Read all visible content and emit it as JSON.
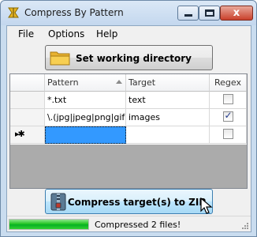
{
  "window": {
    "title": "Compress By Pattern",
    "icon": "compress-app-icon",
    "controls": {
      "minimize": "minimize-icon",
      "maximize": "maximize-icon",
      "close_label": "x"
    }
  },
  "menu": [
    {
      "label": "File"
    },
    {
      "label": "Options"
    },
    {
      "label": "Help"
    }
  ],
  "buttons": {
    "set_working_directory": "Set working directory",
    "compress_zip": "Compress target(s) to ZIP"
  },
  "grid": {
    "columns": {
      "pattern": "Pattern",
      "target": "Target",
      "regex": "Regex"
    },
    "sort_column": "Pattern",
    "rows": [
      {
        "pattern": "*.txt",
        "target": "text",
        "regex": false
      },
      {
        "pattern": "\\.(jpg|jpeg|png|gif)$",
        "target": "images",
        "regex": true
      }
    ],
    "new_row_marker": "▸✱"
  },
  "status": {
    "progress_percent": 100,
    "text": "Compressed 2 files!"
  },
  "colors": {
    "progress": "#06b025",
    "selection": "#3399ff",
    "zip_button": "#bee6fd"
  }
}
